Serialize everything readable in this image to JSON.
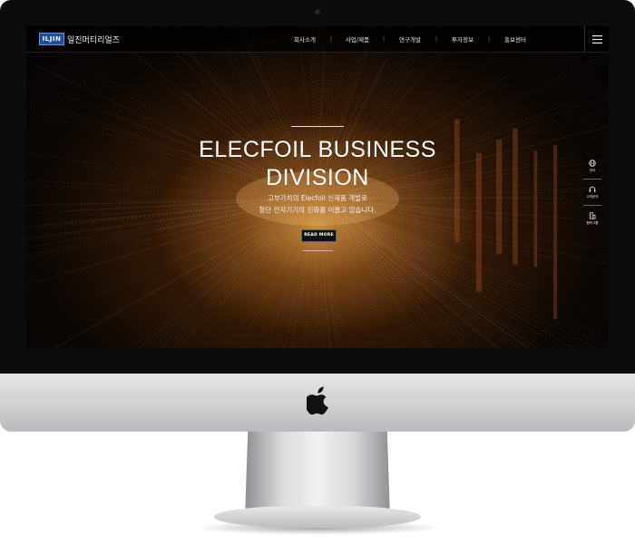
{
  "brand": {
    "mark": "ILJIN",
    "name": "일진머티리얼즈"
  },
  "nav": {
    "items": [
      "회사소개",
      "사업/제품",
      "연구개발",
      "투자정보",
      "홍보센터"
    ]
  },
  "hero": {
    "title_line1": "ELECFOIL BUSINESS",
    "title_line2": "DIVISION",
    "sub_line1": "고부가치의 Elecfoil 신제품 개발로",
    "sub_line2": "첨단 전자기기의 진화를 이끌고 있습니다.",
    "button": "READ MORE"
  },
  "quick_menu": {
    "items": [
      "언어",
      "고객문의",
      "협력그룹"
    ]
  },
  "icons": {
    "menu": "hamburger-icon",
    "language": "globe-icon",
    "contact": "headset-icon",
    "group": "building-icon",
    "apple": "apple-logo"
  },
  "colors": {
    "brand_blue": "#1d4fa3",
    "hero_glow": "#c58b3f",
    "bezel": "#0c0c0c"
  }
}
